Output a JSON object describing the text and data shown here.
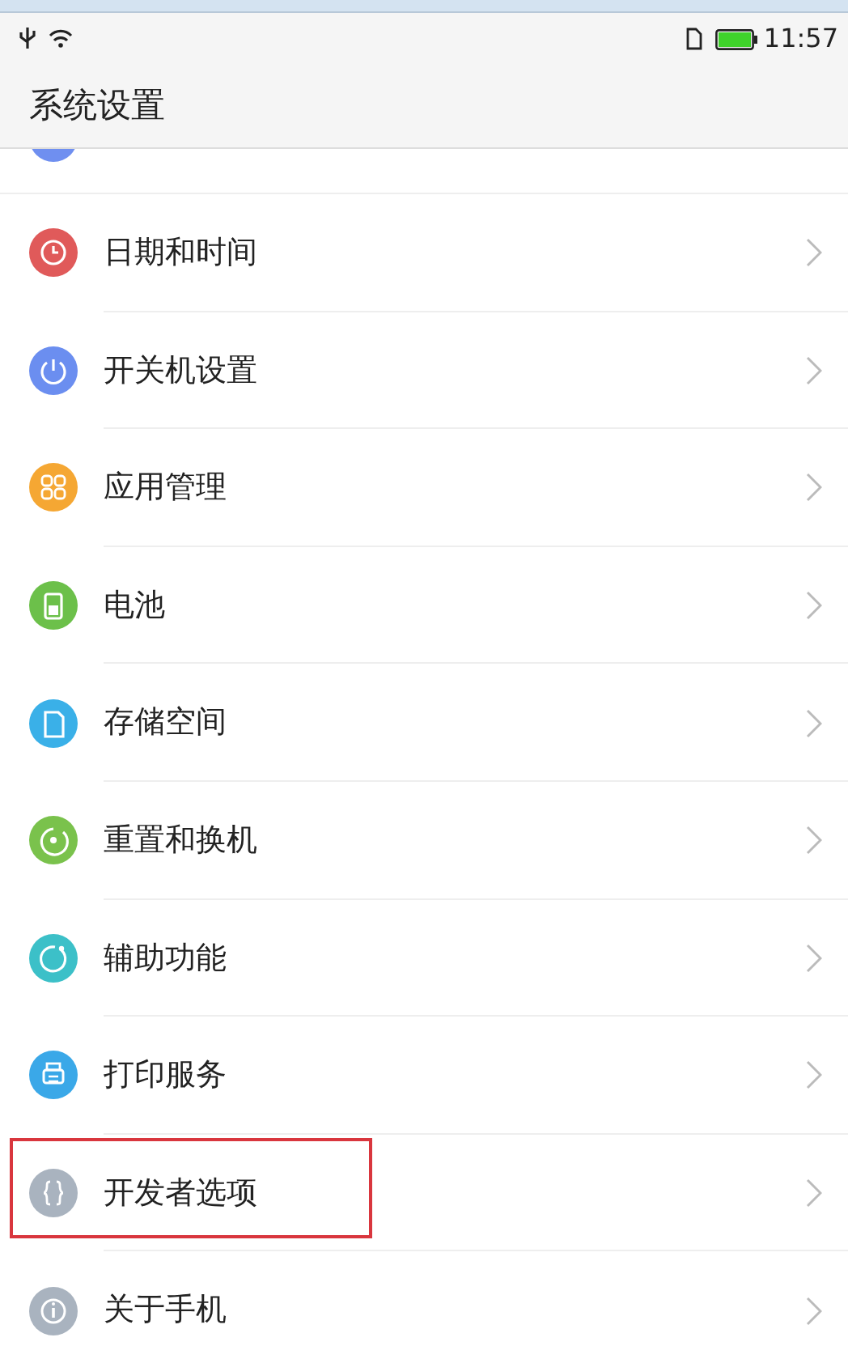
{
  "status_bar": {
    "time": "11:57"
  },
  "header": {
    "title": "系统设置"
  },
  "partial_item": {
    "color": "#6f8ff0"
  },
  "items": [
    {
      "label": "日期和时间",
      "color": "#e05a5a",
      "highlighted": false
    },
    {
      "label": "开关机设置",
      "color": "#6b8ef0",
      "highlighted": false
    },
    {
      "label": "应用管理",
      "color": "#f5a733",
      "highlighted": false
    },
    {
      "label": "电池",
      "color": "#6cc04a",
      "highlighted": false
    },
    {
      "label": "存储空间",
      "color": "#3ab0e8",
      "highlighted": false
    },
    {
      "label": "重置和换机",
      "color": "#7ac24c",
      "highlighted": false
    },
    {
      "label": "辅助功能",
      "color": "#3cc0c8",
      "highlighted": false
    },
    {
      "label": "打印服务",
      "color": "#3aa8e8",
      "highlighted": false
    },
    {
      "label": "开发者选项",
      "color": "#a9b3bf",
      "highlighted": true
    },
    {
      "label": "关于手机",
      "color": "#a9b3bf",
      "highlighted": false
    }
  ]
}
